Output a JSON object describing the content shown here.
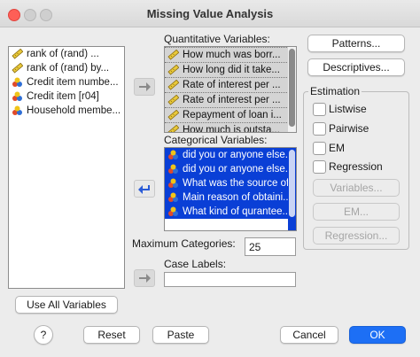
{
  "window": {
    "title": "Missing Value Analysis"
  },
  "source_list": {
    "items": [
      {
        "label": "rank of (rand)          ...",
        "icon": "scale-ruler-icon"
      },
      {
        "label": "rank of (rand)      by...",
        "icon": "scale-ruler-icon"
      },
      {
        "label": "Credit item numbe...",
        "icon": "nominal-balls-icon"
      },
      {
        "label": "Credit item [r04]",
        "icon": "nominal-balls-icon"
      },
      {
        "label": "Household membe...",
        "icon": "nominal-balls-icon"
      }
    ]
  },
  "quantitative": {
    "label": "Quantitative Variables:",
    "items": [
      {
        "label": "How much was borr...",
        "icon": "scale-ruler-icon"
      },
      {
        "label": "How long did it take...",
        "icon": "scale-ruler-icon"
      },
      {
        "label": "Rate of interest per ...",
        "icon": "scale-ruler-icon"
      },
      {
        "label": "Rate of interest per ...",
        "icon": "scale-ruler-icon"
      },
      {
        "label": "Repayment of loan i...",
        "icon": "scale-ruler-icon"
      },
      {
        "label": "How much is outsta...",
        "icon": "scale-ruler-icon"
      }
    ]
  },
  "categorical": {
    "label": "Categorical Variables:",
    "items": [
      {
        "label": "did you or anyone else...",
        "icon": "nominal-balls-icon"
      },
      {
        "label": "did you or anyone else...",
        "icon": "nominal-balls-icon"
      },
      {
        "label": "What was the source of...",
        "icon": "nominal-balls-icon"
      },
      {
        "label": "Main reason of obtaini...",
        "icon": "nominal-balls-icon"
      },
      {
        "label": "What kind of qurantee...",
        "icon": "nominal-balls-icon"
      }
    ]
  },
  "max_categories": {
    "label": "Maximum Categories:",
    "value": "25"
  },
  "case_labels": {
    "label": "Case Labels:",
    "value": ""
  },
  "buttons": {
    "patterns": "Patterns...",
    "descriptives": "Descriptives...",
    "use_all": "Use All Variables",
    "help": "?",
    "reset": "Reset",
    "paste": "Paste",
    "cancel": "Cancel",
    "ok": "OK"
  },
  "estimation": {
    "label": "Estimation",
    "options": [
      "Listwise",
      "Pairwise",
      "EM",
      "Regression"
    ],
    "variables_btn": "Variables...",
    "em_btn": "EM...",
    "regression_btn": "Regression..."
  },
  "colors": {
    "selection": "#0a3fd6",
    "ok_button": "#1d6ff5",
    "close_light": "#fe5f57"
  }
}
